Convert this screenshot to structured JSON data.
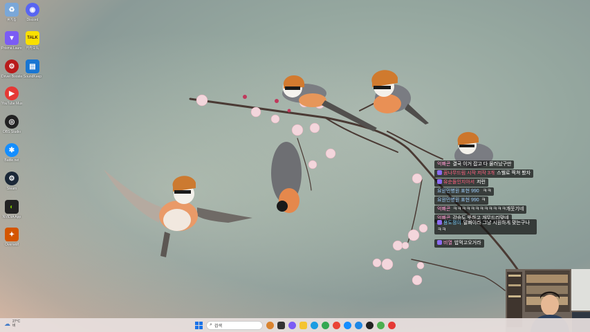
{
  "desktop": {
    "icons": [
      {
        "label": "휴지통",
        "icon": "recycle-bin-icon",
        "color": "#7aa7d8"
      },
      {
        "label": "Discord",
        "icon": "discord-icon",
        "color": "#5865f2"
      },
      {
        "label": "Prisma Launcher",
        "icon": "prism-icon",
        "color": "#7b5cf5"
      },
      {
        "label": "카카오톡",
        "icon": "kakaotalk-icon",
        "color": "#f9e000"
      },
      {
        "label": "Driver Booster 11",
        "icon": "driver-booster-icon",
        "color": "#b81b1b"
      },
      {
        "label": "SoundKeep",
        "icon": "app-icon",
        "color": "#1976d2"
      },
      {
        "label": "YouTube Music",
        "icon": "youtube-music-icon",
        "color": "#e53935"
      },
      {
        "label": "OBS Studio",
        "icon": "obs-icon",
        "color": "#222222"
      },
      {
        "label": "Battle.net",
        "icon": "battlenet-icon",
        "color": "#148eff"
      },
      {
        "label": "Steam",
        "icon": "steam-icon",
        "color": "#1b2838"
      },
      {
        "label": "NVIDIA App",
        "icon": "nvidia-icon",
        "color": "#222222"
      },
      {
        "label": "Overwolf",
        "icon": "overwolf-icon",
        "color": "#d45500"
      }
    ]
  },
  "chat": {
    "messages": [
      {
        "nick": "억빠콘",
        "text": "결국 이거 잡고 다 물러났구만",
        "badge": false,
        "nick_color": "#ff9ad1"
      },
      {
        "nick": "꿈나무드림 시작 저작 3개",
        "text": "스웰로 찍쳐 봤자",
        "badge": true,
        "nick_color": "#ff5f7e"
      },
      {
        "nick": "유순돌인지아서",
        "text": "저런",
        "badge": true,
        "nick_color": "#ff5f7e"
      },
      {
        "nick": "요원민병원 표현 990 ",
        "text": "ㅋㅋ",
        "badge": false,
        "nick_color": "#9fd0ff"
      },
      {
        "nick": "요원민병원 표현 990",
        "text": "ㅋ",
        "badge": false,
        "nick_color": "#9fd0ff"
      },
      {
        "nick": "억빠콘",
        "text": "ㅋㅋㅋㅋㅋㅋㅋㅋㅋㅋㅋㅋ개웃기네",
        "badge": false,
        "nick_color": "#ff9ad1"
      },
      {
        "nick": "억빠콘",
        "text": "강승도 뜻하고 개무드리맞네",
        "badge": false,
        "nick_color": "#ff9ad1"
      },
      {
        "nick": "용도쟁이",
        "text": "말빠이라 그냥 시원하게 맞는구나 ㅋㅋ",
        "badge": true,
        "nick_color": "#7fd3ff"
      },
      {
        "nick": "비열",
        "text": "밥먹고오거라",
        "badge": true,
        "nick_color": "#ff9ad1"
      }
    ]
  },
  "taskbar": {
    "weather": {
      "temp": "27°C",
      "desc": "비"
    },
    "search_placeholder": "검색",
    "apps": [
      {
        "icon": "ramen-icon",
        "color": "#d9832f"
      },
      {
        "icon": "task-view-icon",
        "color": "#333333"
      },
      {
        "icon": "copilot-icon",
        "color": "#7b5cf5"
      },
      {
        "icon": "file-explorer-icon",
        "color": "#f4c430"
      },
      {
        "icon": "edge-icon",
        "color": "#1b9de2"
      },
      {
        "icon": "chrome-icon",
        "color": "#34a853"
      },
      {
        "icon": "chrome-icon",
        "color": "#ea4335"
      },
      {
        "icon": "battlenet-icon",
        "color": "#148eff"
      },
      {
        "icon": "browser-icon",
        "color": "#1e88e5"
      },
      {
        "icon": "obs-icon",
        "color": "#222222"
      },
      {
        "icon": "app-icon",
        "color": "#4caf50"
      },
      {
        "icon": "app-icon",
        "color": "#e53935"
      }
    ]
  }
}
